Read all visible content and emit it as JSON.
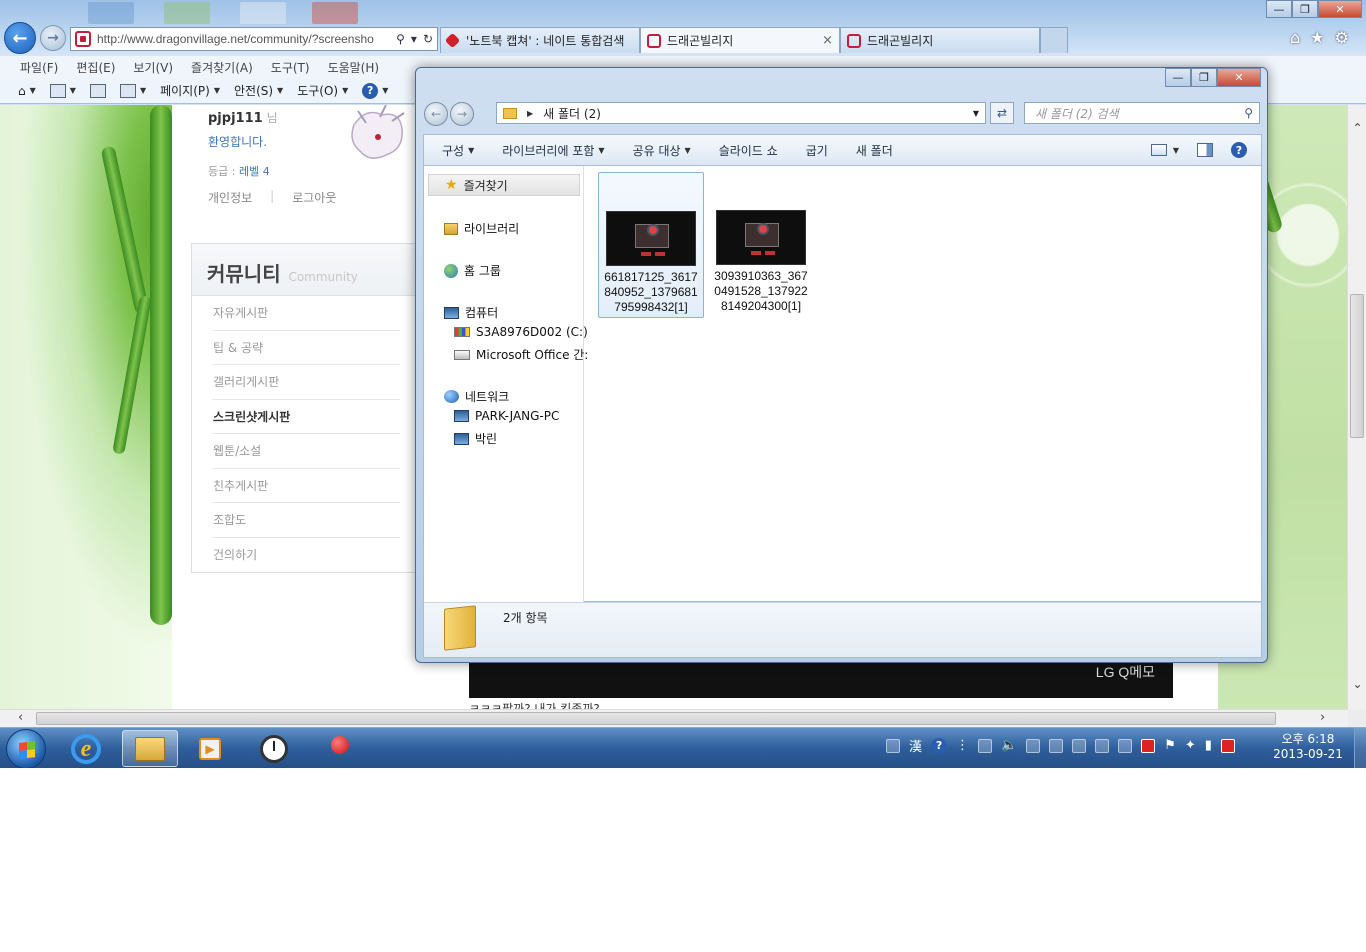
{
  "browser": {
    "address_url": "http://www.dragonvillage.net/community/?screensho",
    "tabs": [
      {
        "label": "'노트북 캡쳐' : 네이트 통합검색"
      },
      {
        "label": "드래곤빌리지",
        "close": "×"
      },
      {
        "label": "드래곤빌리지"
      }
    ],
    "window_controls": {
      "minimize": "—",
      "maximize": "❐",
      "close": "✕"
    },
    "menu": [
      "파일(F)",
      "편집(E)",
      "보기(V)",
      "즐겨찾기(A)",
      "도구(T)",
      "도움말(H)"
    ],
    "command_bar": {
      "page": "페이지(P)",
      "safety": "안전(S)",
      "tools": "도구(O)"
    }
  },
  "webpage": {
    "username": "pjpj111",
    "username_suffix": "님",
    "welcome": "환영합니다.",
    "level_label": "등급 :",
    "level_value": "레벨 4",
    "links": [
      "개인정보",
      "로그아웃"
    ],
    "community_title": "커뮤니티",
    "community_sub": "Community",
    "community_items": [
      {
        "label": "자유게시판",
        "active": false
      },
      {
        "label": "팁 & 공략",
        "active": false
      },
      {
        "label": "갤러리게시판",
        "active": false
      },
      {
        "label": "스크린샷게시판",
        "active": true
      },
      {
        "label": "웹툰/소설",
        "active": false
      },
      {
        "label": "친추게시판",
        "active": false
      },
      {
        "label": "조합도",
        "active": false
      },
      {
        "label": "건의하기",
        "active": false
      }
    ],
    "video_label": "LG Q메모",
    "comment_text": "ㅋㅋㅋ팔까? 내가 킨좀까?"
  },
  "explorer": {
    "path": "새 폴더 (2)",
    "search_placeholder": "새 폴더 (2) 검색",
    "toolbar": [
      "구성",
      "라이브러리에 포함",
      "공유 대상",
      "슬라이드 쇼",
      "굽기",
      "새 폴더"
    ],
    "toolbar_dropdowns": [
      true,
      true,
      true,
      false,
      false,
      false
    ],
    "nav": {
      "favorites": "즐겨찾기",
      "libraries": "라이브러리",
      "homegroup": "홈 그룹",
      "computer": "컴퓨터",
      "drive_c": "S3A8976D002 (C:)",
      "drive_office": "Microsoft Office 간:",
      "network": "네트워크",
      "pc1": "PARK-JANG-PC",
      "pc2": "박린"
    },
    "files": [
      {
        "name": "661817125_3617840952_1379681795998432[1]",
        "selected": true
      },
      {
        "name": "3093910363_3670491528_1379228149204300[1]",
        "selected": false
      }
    ],
    "item_count": "2개 항목"
  },
  "taskbar": {
    "tray_ime": "漢",
    "clock_time": "오후 6:18",
    "clock_date": "2013-09-21"
  }
}
